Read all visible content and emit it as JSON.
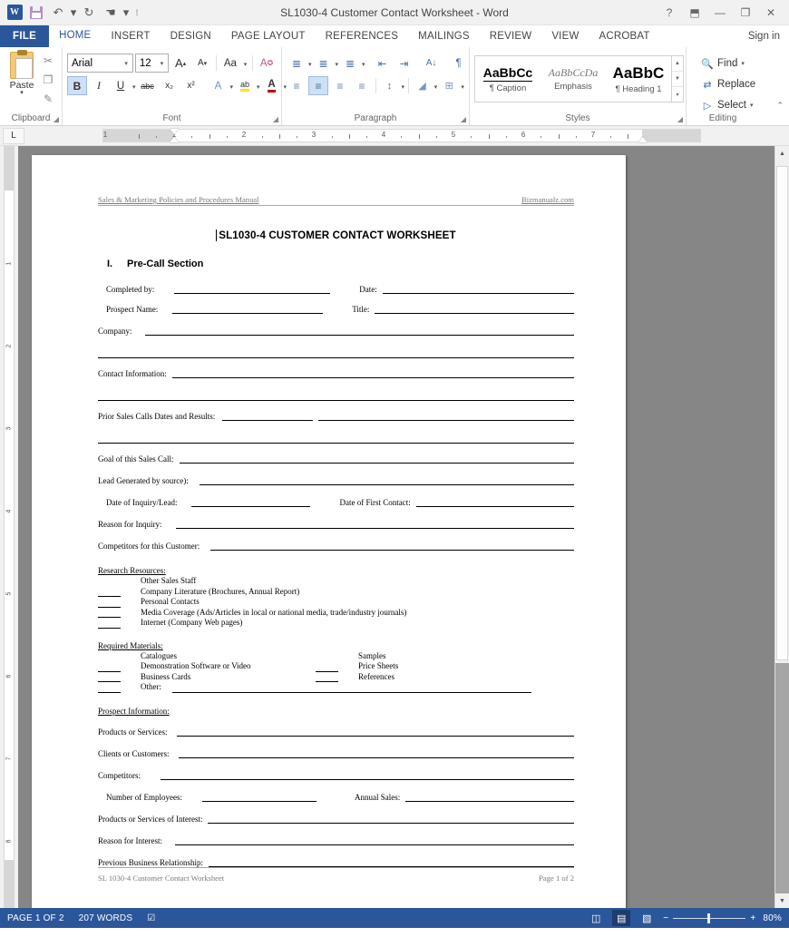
{
  "titlebar": {
    "document_title": "SL1030-4 Customer Contact Worksheet - Word",
    "qat": [
      {
        "name": "word-logo-icon",
        "label": "W"
      },
      {
        "name": "save-icon",
        "label": ""
      },
      {
        "name": "undo-icon",
        "label": "↶"
      },
      {
        "name": "undo-caret-icon",
        "label": "▾"
      },
      {
        "name": "redo-icon",
        "label": "↻"
      },
      {
        "name": "touch-mouse-mode-icon",
        "label": "☚"
      },
      {
        "name": "touch-caret-icon",
        "label": "▾"
      },
      {
        "name": "customize-qat-icon",
        "label": "≡"
      }
    ],
    "window_buttons": [
      {
        "name": "help-button",
        "glyph": "?"
      },
      {
        "name": "ribbon-display-options-button",
        "glyph": "⬒"
      },
      {
        "name": "minimize-button",
        "glyph": "—"
      },
      {
        "name": "restore-button",
        "glyph": "❐"
      },
      {
        "name": "close-button",
        "glyph": "✕"
      }
    ]
  },
  "tabs": {
    "file": "FILE",
    "items": [
      "HOME",
      "INSERT",
      "DESIGN",
      "PAGE LAYOUT",
      "REFERENCES",
      "MAILINGS",
      "REVIEW",
      "VIEW",
      "ACROBAT"
    ],
    "active": "HOME",
    "signin": "Sign in"
  },
  "ribbon": {
    "groups": [
      {
        "name": "clipboard",
        "label": "Clipboard"
      },
      {
        "name": "font",
        "label": "Font"
      },
      {
        "name": "paragraph",
        "label": "Paragraph"
      },
      {
        "name": "styles",
        "label": "Styles"
      },
      {
        "name": "editing",
        "label": "Editing"
      }
    ],
    "clipboard": {
      "paste_label": "Paste",
      "cut_icon": "✂",
      "copy_icon": "❐",
      "format_painter_icon": "✎"
    },
    "font": {
      "font_name": "Arial",
      "font_size": "12",
      "grow_font": "A",
      "shrink_font": "A",
      "change_case": "Aa",
      "clear_formatting": "A",
      "bold": "B",
      "italic": "I",
      "underline": "U",
      "strikethrough": "abc",
      "subscript": "x₂",
      "superscript": "x²",
      "text_effects": "A",
      "highlight": "ab",
      "font_color": "A"
    },
    "paragraph": {
      "bullets": "≣",
      "numbering": "≣",
      "multilevel": "≣",
      "decrease_indent": "⇤",
      "increase_indent": "⇥",
      "sort": "A↓",
      "show_marks": "¶",
      "align_left": "≡",
      "align_center": "≡",
      "align_right": "≡",
      "justify": "≡",
      "line_spacing": "↕",
      "shading": "◢",
      "borders": "⊞"
    },
    "styles": {
      "items": [
        {
          "preview": "AaBbCc",
          "name": "¶ Caption"
        },
        {
          "preview": "AaBbCcDa",
          "name": "Emphasis"
        },
        {
          "preview": "AaBbC",
          "name": "¶ Heading 1"
        }
      ]
    },
    "editing": {
      "find": "Find",
      "replace": "Replace",
      "select": "Select"
    },
    "collapse_icon": "⌃"
  },
  "ruler": {
    "tab_stop_label": "L",
    "horizontal_numbers": [
      "1",
      "2",
      "3",
      "4",
      "5",
      "6",
      "7"
    ],
    "vertical_numbers": [
      "1",
      "2",
      "3",
      "4",
      "5",
      "6",
      "7",
      "8"
    ]
  },
  "document": {
    "header_left": "Sales & Marketing Policies and Procedures Manual",
    "header_right": "Bizmanualz.com",
    "title": "SL1030-4 CUSTOMER CONTACT WORKSHEET",
    "section_number": "I.",
    "section_title": "Pre-Call Section",
    "fields": {
      "completed_by": "Completed by:",
      "date": "Date:",
      "prospect_name": "Prospect Name:",
      "title": "Title:",
      "company": "Company:",
      "contact_information": "Contact Information:",
      "prior_sales_calls": "Prior Sales Calls Dates and Results:",
      "goal_of_sales_call": "Goal of this Sales Call:",
      "lead_generated": "Lead Generated by source):",
      "date_of_inquiry": "Date of Inquiry/Lead:",
      "date_of_first_contact": "Date of First Contact:",
      "reason_for_inquiry": "Reason for Inquiry:",
      "competitors_for_customer": "Competitors for this Customer:",
      "products_or_services": "Products or Services:",
      "clients_or_customers": "Clients or Customers:",
      "competitors": "Competitors:",
      "number_of_employees": "Number of Employees:",
      "annual_sales": "Annual Sales:",
      "products_of_interest": "Products or Services of Interest:",
      "reason_for_interest": "Reason for Interest:",
      "previous_relationship": "Previous Business Relationship:"
    },
    "research_resources": {
      "heading": "Research Resources:",
      "items": [
        "Other Sales Staff",
        "Company Literature (Brochures, Annual Report)",
        "Personal Contacts",
        "Media Coverage (Ads/Articles in local or national media, trade/industry journals)",
        "Internet (Company Web pages)"
      ]
    },
    "required_materials": {
      "heading": "Required Materials:",
      "left_items": [
        "Catalogues",
        "Demonstration Software or Video",
        "Business Cards",
        "Other:"
      ],
      "right_items": [
        "Samples",
        "Price Sheets",
        "References"
      ]
    },
    "prospect_information_heading": "Prospect Information:",
    "footer_left": "SL 1030-4 Customer Contact Worksheet",
    "footer_right": "Page 1 of 2"
  },
  "statusbar": {
    "page": "PAGE 1 OF 2",
    "words": "207 WORDS",
    "proofing_icon": "☑",
    "views": [
      {
        "name": "read-mode-button",
        "glyph": "◫"
      },
      {
        "name": "print-layout-button",
        "glyph": "▤"
      },
      {
        "name": "web-layout-button",
        "glyph": "▧"
      }
    ],
    "zoom_out": "−",
    "zoom_in": "+",
    "zoom_level": "80%"
  }
}
